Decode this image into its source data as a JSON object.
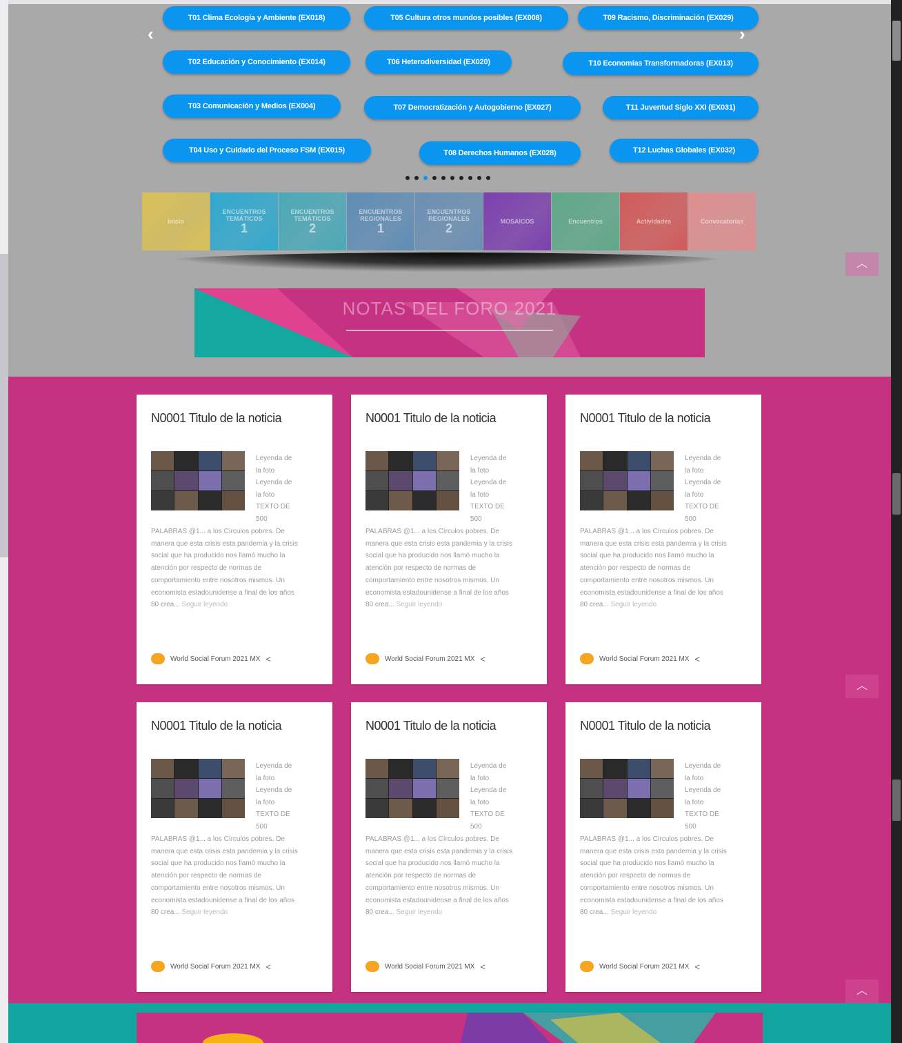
{
  "carousel": {
    "prev_arrow": "‹",
    "next_arrow": "›",
    "pills": [
      "T01 Clima Ecología y Ambiente (EX018)",
      "T05 Cultura otros mundos posibles (EX008)",
      "T09 Racismo, Discriminación (EX029)",
      "T02 Educación y Conocimiento (EX014)",
      "T06 Heterodiversidad (EX020)",
      "T10 Economías Transformadoras (EX013)",
      "T03 Comunicación y Medios (EX004)",
      "T07 Democratización y Autogobierno (EX027)",
      "T11 Juventud Siglo XXI (EX031)",
      "T04 Uso y Cuidado del Proceso FSM (EX015)",
      "T08 Derechos Humanos (EX028)",
      "T12 Luchas Globales (EX032)"
    ],
    "dots_count": 10,
    "active_dot": 2
  },
  "tiles": [
    {
      "label": "Inicio",
      "num": "",
      "color": "#d8c058"
    },
    {
      "label": "ENCUENTROS TEMÁTICOS",
      "num": "1",
      "color": "#2fa9cf"
    },
    {
      "label": "ENCUENTROS TEMÁTICOS",
      "num": "2",
      "color": "#4aa9b8"
    },
    {
      "label": "ENCUENTROS REGIONALES",
      "num": "1",
      "color": "#5f8db6"
    },
    {
      "label": "ENCUENTROS REGIONALES",
      "num": "2",
      "color": "#6a8fb4"
    },
    {
      "label": "MOSAICOS",
      "num": "",
      "color": "#7b3fae"
    },
    {
      "label": "Encuentros",
      "num": "",
      "color": "#5fa88a"
    },
    {
      "label": "Actividades",
      "num": "",
      "color": "#d35a5a"
    },
    {
      "label": "Convocatorias",
      "num": "",
      "color": "#df8f8f"
    }
  ],
  "banner": {
    "title": "NOTAS DEL FORO 2021"
  },
  "scroll_up": "︿",
  "cards": [
    {
      "title": "N0001 Titulo de la noticia",
      "caption": "Leyenda de la foto Leyenda de la foto TEXTO DE 500",
      "body": "PALABRAS @1... a los Círculos pobres. De manera que esta crisis esta pandemia y la crisis social que ha producido nos llamó mucho la atención por respecto de normas de comportamiento entre nosotros mismos. Un economista estadounidense a final de los años 80 crea...",
      "more": "Seguir leyendo",
      "source": "World Social Forum 2021 MX"
    },
    {
      "title": "N0001 Titulo de la noticia",
      "caption": "Leyenda de la foto Leyenda de la foto TEXTO DE 500",
      "body": "PALABRAS @1... a los Círculos pobres. De manera que esta crisis esta pandemia y la crisis social que ha producido nos llamó mucho la atención por respecto de normas de comportamiento entre nosotros mismos. Un economista estadounidense a final de los años 80 crea...",
      "more": "Seguir leyendo",
      "source": "World Social Forum 2021 MX"
    },
    {
      "title": "N0001 Titulo de la noticia",
      "caption": "Leyenda de la foto Leyenda de la foto TEXTO DE 500",
      "body": "PALABRAS @1... a los Círculos pobres. De manera que esta crisis esta pandemia y la crisis social que ha producido nos llamó mucho la atención por respecto de normas de comportamiento entre nosotros mismos. Un economista estadounidense a final de los años 80 crea...",
      "more": "Seguir leyendo",
      "source": "World Social Forum 2021 MX"
    },
    {
      "title": "N0001 Titulo de la noticia",
      "caption": "Leyenda de la foto Leyenda de la foto TEXTO DE 500",
      "body": "PALABRAS @1... a los Círculos pobres. De manera que esta crisis esta pandemia y la crisis social que ha producido nos llamó mucho la atención por respecto de normas de comportamiento entre nosotros mismos. Un economista estadounidense a final de los años 80 crea...",
      "more": "Seguir leyendo",
      "source": "World Social Forum 2021 MX"
    },
    {
      "title": "N0001 Titulo de la noticia",
      "caption": "Leyenda de la foto Leyenda de la foto TEXTO DE 500",
      "body": "PALABRAS @1... a los Círculos pobres. De manera que esta crisis esta pandemia y la crisis social que ha producido nos llamó mucho la atención por respecto de normas de comportamiento entre nosotros mismos. Un economista estadounidense a final de los años 80 crea...",
      "more": "Seguir leyendo",
      "source": "World Social Forum 2021 MX"
    },
    {
      "title": "N0001 Titulo de la noticia",
      "caption": "Leyenda de la foto Leyenda de la foto TEXTO DE 500",
      "body": "PALABRAS @1... a los Círculos pobres. De manera que esta crisis esta pandemia y la crisis social que ha producido nos llamó mucho la atención por respecto de normas de comportamiento entre nosotros mismos. Un economista estadounidense a final de los años 80 crea...",
      "more": "Seguir leyendo",
      "source": "World Social Forum 2021 MX"
    }
  ],
  "colors": {
    "pill_blue": "#0a96f0",
    "pink": "#c63282",
    "teal": "#12a5a0",
    "gray": "#a9a9a9"
  }
}
